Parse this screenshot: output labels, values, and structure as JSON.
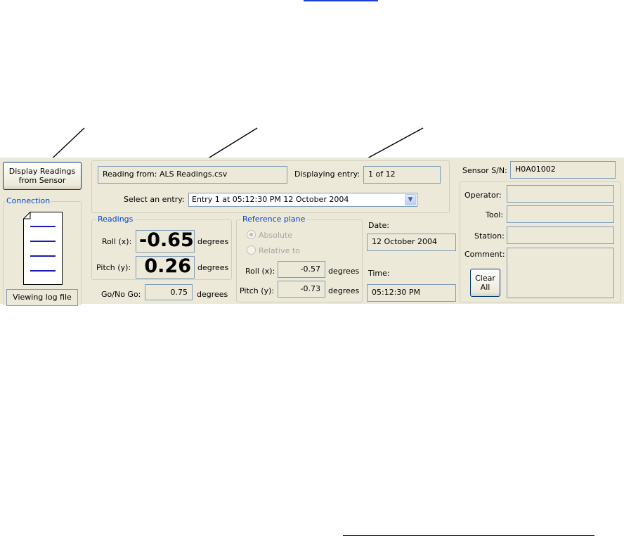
{
  "toolbar": {
    "display_readings_label": "Display Readings\nfrom Sensor"
  },
  "connection": {
    "title": "Connection",
    "status": "Viewing log file"
  },
  "file_panel": {
    "reading_from": "Reading from: ALS Readings.csv",
    "displaying_entry_label": "Displaying entry:",
    "displaying_entry_value": "1 of 12",
    "select_entry_label": "Select an entry:",
    "select_entry_value": "Entry 1 at 05:12:30 PM 12 October 2004"
  },
  "readings": {
    "title": "Readings",
    "roll_label": "Roll (x):",
    "roll_value": "-0.65",
    "pitch_label": "Pitch (y):",
    "pitch_value": "0.26",
    "unit": "degrees",
    "go_nogo_label": "Go/No Go:",
    "go_nogo_value": "0.75"
  },
  "reference_plane": {
    "title": "Reference plane",
    "absolute_label": "Absolute",
    "relative_label": "Relative to",
    "roll_label": "Roll (x):",
    "roll_value": "-0.57",
    "pitch_label": "Pitch (y):",
    "pitch_value": "-0.73",
    "unit": "degrees"
  },
  "datetime": {
    "date_label": "Date:",
    "date_value": "12 October 2004",
    "time_label": "Time:",
    "time_value": "05:12:30 PM"
  },
  "sensor": {
    "sn_label": "Sensor S/N:",
    "sn_value": "H0A01002"
  },
  "details": {
    "operator_label": "Operator:",
    "tool_label": "Tool:",
    "station_label": "Station:",
    "comment_label": "Comment:",
    "clear_all_label": "Clear\nAll",
    "operator_value": "",
    "tool_value": "",
    "station_value": "",
    "comment_value": ""
  },
  "colors": {
    "window_bg": "#ece9d8",
    "group_title": "#0046d5",
    "field_border": "#7f9db9",
    "document_lines": "#1c1cb0"
  }
}
